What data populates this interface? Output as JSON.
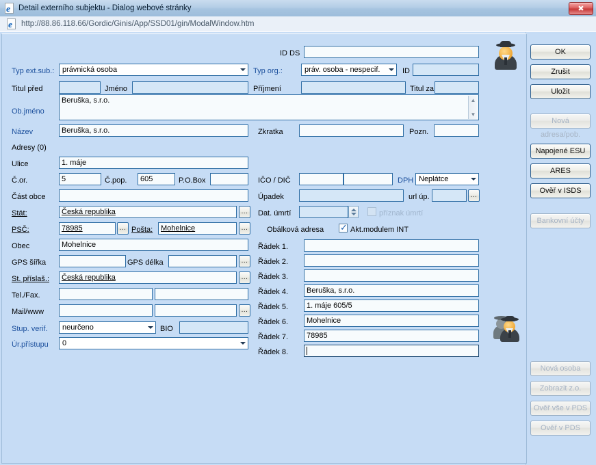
{
  "window": {
    "title": "Detail externího subjektu - Dialog webové stránky",
    "close_label": "✖",
    "url": "http://88.86.118.66/Gordic/Ginis/App/SSD01/gin/ModalWindow.htm",
    "ie_glyph": "e"
  },
  "colors": {
    "window_bg": "#c6dcf5",
    "label_blue": "#1b4f9c",
    "field_border": "#2e6da4",
    "field_bg": "#f7fbfd",
    "field_readonly_bg": "#d5e7f7",
    "close_red": "#c73a3a"
  },
  "form": {
    "id_ds": {
      "label": "ID DS",
      "value": ""
    },
    "typ_ext_sub": {
      "label": "Typ ext.sub.:",
      "value": "právnická osoba"
    },
    "typ_org": {
      "label": "Typ org.:",
      "value": "práv. osoba - nespecif."
    },
    "id": {
      "label": "ID",
      "value": ""
    },
    "titul_pred": {
      "label": "Titul před",
      "value": ""
    },
    "jmeno": {
      "label": "Jméno",
      "value": ""
    },
    "prijmeni": {
      "label": "Příjmení",
      "value": ""
    },
    "titul_za": {
      "label": "Titul za",
      "value": ""
    },
    "ob_jmeno": {
      "label": "Ob.jméno",
      "value": "Beruška, s.r.o."
    },
    "nazev": {
      "label": "Název",
      "value": "Beruška, s.r.o."
    },
    "zkratka": {
      "label": "Zkratka",
      "value": ""
    },
    "pozn": {
      "label": "Pozn.",
      "value": ""
    },
    "adresy": {
      "label": "Adresy (0)"
    },
    "ulice": {
      "label": "Ulice",
      "value": "1. máje"
    },
    "c_or": {
      "label": "Č.or.",
      "value": "5"
    },
    "c_pop": {
      "label": "Č.pop.",
      "value": "605"
    },
    "po_box": {
      "label": "P.O.Box",
      "value": ""
    },
    "ico_dic": {
      "label": "IČO / DIČ",
      "ico": "",
      "dic": ""
    },
    "dph": {
      "label": "DPH",
      "value": "Neplátce"
    },
    "cast_obce": {
      "label": "Část obce",
      "value": ""
    },
    "upadek": {
      "label": "Úpadek",
      "value": ""
    },
    "url_up": {
      "label": "url úp.",
      "value": "",
      "browse": "..."
    },
    "stat": {
      "label": "Stát:",
      "value": "Česká republika",
      "browse": "..."
    },
    "dat_umrti": {
      "label": "Dat. úmrtí",
      "value": ""
    },
    "priznak_umrti": {
      "label": "příznak úmrtí",
      "checked": false
    },
    "psc": {
      "label": "PSČ:",
      "value": "78985",
      "browse": "..."
    },
    "posta": {
      "label": "Pošta:",
      "value": "Mohelnice",
      "browse": "..."
    },
    "obalkova_adresa": {
      "label": "Obálková adresa"
    },
    "akt_modulem_int": {
      "label": "Akt.modulem INT",
      "checked": true
    },
    "obec": {
      "label": "Obec",
      "value": "Mohelnice"
    },
    "gps_sirka": {
      "label": "GPS šířka",
      "value": ""
    },
    "gps_delka": {
      "label": "GPS délka",
      "value": "",
      "browse": "..."
    },
    "st_prislus": {
      "label": "St. příslaš.:",
      "value": "Česká republika",
      "browse": "..."
    },
    "tel_fax": {
      "label": "Tel./Fax.",
      "tel": "",
      "fax": ""
    },
    "mail_www": {
      "label": "Mail/www",
      "mail": "",
      "www": "",
      "browse": "..."
    },
    "stup_verif": {
      "label": "Stup. verif.",
      "value": "neurčeno"
    },
    "bio": {
      "label": "BIO",
      "value": ""
    },
    "ur_pristupu": {
      "label": "Úr.přístupu",
      "value": "0"
    },
    "radky": [
      {
        "label": "Řádek 1.",
        "value": ""
      },
      {
        "label": "Řádek 2.",
        "value": ""
      },
      {
        "label": "Řádek 3.",
        "value": ""
      },
      {
        "label": "Řádek 4.",
        "value": "Beruška, s.r.o."
      },
      {
        "label": "Řádek 5.",
        "value": "1. máje 605/5"
      },
      {
        "label": "Řádek 6.",
        "value": "Mohelnice"
      },
      {
        "label": "Řádek 7.",
        "value": "78985"
      },
      {
        "label": "Řádek 8.",
        "value": ""
      }
    ]
  },
  "buttons": [
    {
      "label": "OK",
      "enabled": true
    },
    {
      "label": "Zrušit",
      "enabled": true
    },
    {
      "label": "Uložit",
      "enabled": true
    },
    {
      "label": "Nová adresa/pob.",
      "enabled": false
    },
    {
      "label": "Napojené ESU",
      "enabled": true
    },
    {
      "label": "ARES",
      "enabled": true
    },
    {
      "label": "Ověř v ISDS",
      "enabled": true
    },
    {
      "label": "Bankovní účty",
      "enabled": false
    },
    {
      "label": "Nová osoba",
      "enabled": false
    },
    {
      "label": "Zobrazit z.o.",
      "enabled": false
    },
    {
      "label": "Ověř vše v PDS",
      "enabled": false
    },
    {
      "label": "Ověř v PDS",
      "enabled": false
    }
  ]
}
